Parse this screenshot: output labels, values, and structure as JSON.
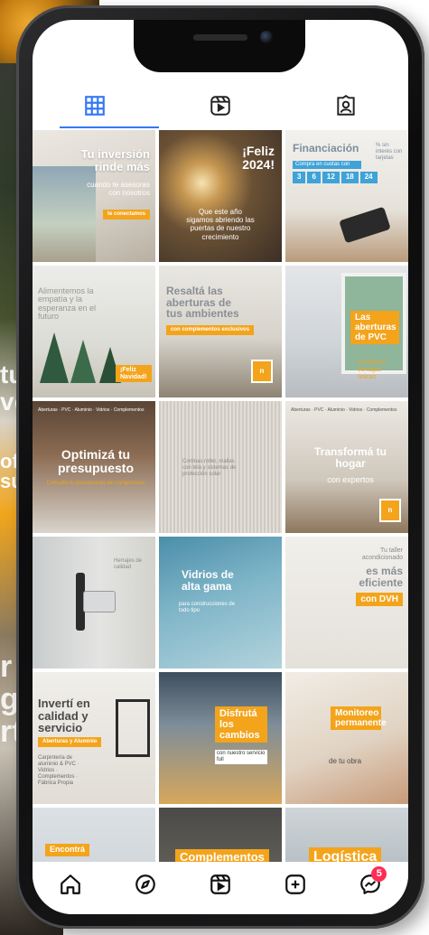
{
  "background": {
    "words_1": "tu\nvo",
    "words_2": "ofi\nsú",
    "words_3": "r\ng\nrt"
  },
  "tabs": [
    {
      "name": "grid",
      "icon": "grid-icon",
      "active": true
    },
    {
      "name": "reels",
      "icon": "reels-icon",
      "active": false
    },
    {
      "name": "tagged",
      "icon": "tagged-icon",
      "active": false
    }
  ],
  "posts": {
    "p1": {
      "title": "Tu inversión rinde más",
      "sub": "cuando te asesoras con nosotros",
      "badge": "te conectamos"
    },
    "p2": {
      "title": "¡Feliz 2024!",
      "sub": "Que este año sigamos abriendo las puertas de nuestro crecimiento"
    },
    "p3": {
      "title": "Financiación",
      "sub": "Compra en cuotas con",
      "cuotas": [
        "3",
        "6",
        "12",
        "18",
        "24"
      ],
      "side": "% sin interés con tarjetas"
    },
    "p4": {
      "title": "Alimentemos la empatía y la esperanza en el futuro",
      "badge": "¡Feliz Navidad!"
    },
    "p5": {
      "title": "Resaltá las aberturas de tus ambientes",
      "badge": "con complementos exclusivos"
    },
    "p6": {
      "title": "Las aberturas de PVC",
      "sub": "te ofrecen ventajas únicas"
    },
    "p7": {
      "topbar": "Aberturas · PVC · Aluminio · Vidrios · Complementos",
      "title": "Optimizá tu presupuesto",
      "sub": "Consultá tu presupuesto sin compromiso"
    },
    "p8": {
      "sub": "Cortinas roller, mallas con tela y sistemas de protección solar"
    },
    "p9": {
      "topbar": "Aberturas · PVC · Aluminio · Vidrios · Complementos",
      "title": "Transformá tu hogar",
      "sub": "con expertos"
    },
    "p10": {
      "sub": "Herrajes de calidad"
    },
    "p11": {
      "title": "Vidrios de alta gama",
      "sub": "para construcciones de todo tipo"
    },
    "p12": {
      "top": "Tu taller acondicionado",
      "title": "es más eficiente",
      "badge": "con DVH"
    },
    "p13": {
      "title": "Invertí en calidad y servicio",
      "badge": "Aberturas y Aluminio",
      "sub": "Carpintería de aluminio & PVC · Vidrios · Complementos · Fábrica Propia"
    },
    "p14": {
      "title": "Disfrutá los cambios",
      "sub": "con nuestro servicio full"
    },
    "p15": {
      "title": "Monitoreo permanente",
      "sub": "de tu obra"
    },
    "p16": {
      "badge": "Encontrá"
    },
    "p17": {
      "badge": "Complementos"
    },
    "p18": {
      "badge": "Logística"
    }
  },
  "logo_text": "n",
  "nav": [
    {
      "name": "home",
      "icon": "home-icon"
    },
    {
      "name": "explore",
      "icon": "compass-icon"
    },
    {
      "name": "reels",
      "icon": "reels-icon"
    },
    {
      "name": "create",
      "icon": "add-icon"
    },
    {
      "name": "messages",
      "icon": "messenger-icon",
      "badge": "5"
    }
  ],
  "colors": {
    "accent": "#f3a41b",
    "active_tab": "#3478f6",
    "badge": "#ff2d55"
  }
}
